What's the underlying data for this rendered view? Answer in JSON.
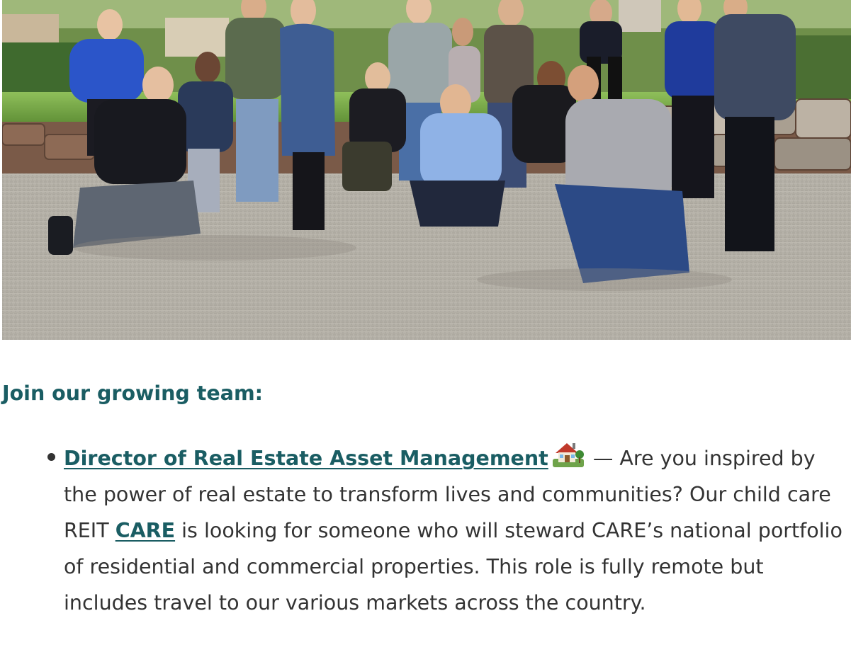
{
  "hero": {
    "alt": "Team photo on the beach"
  },
  "section": {
    "heading": "Join our growing team:"
  },
  "jobs": [
    {
      "title": "Director of Real Estate Asset Management",
      "icon": "house-with-garden-icon",
      "text_before_link": " — Are you inspired by the power of real estate to transform lives and communities? Our child care REIT ",
      "inline_link": "CARE",
      "text_after_link": " is looking for someone who will steward CARE’s national portfolio of residential and commercial properties. This role is fully remote but includes travel to our various markets across the country."
    }
  ],
  "colors": {
    "accent": "#1a5d63",
    "body_text": "#333333",
    "background": "#ffffff"
  }
}
